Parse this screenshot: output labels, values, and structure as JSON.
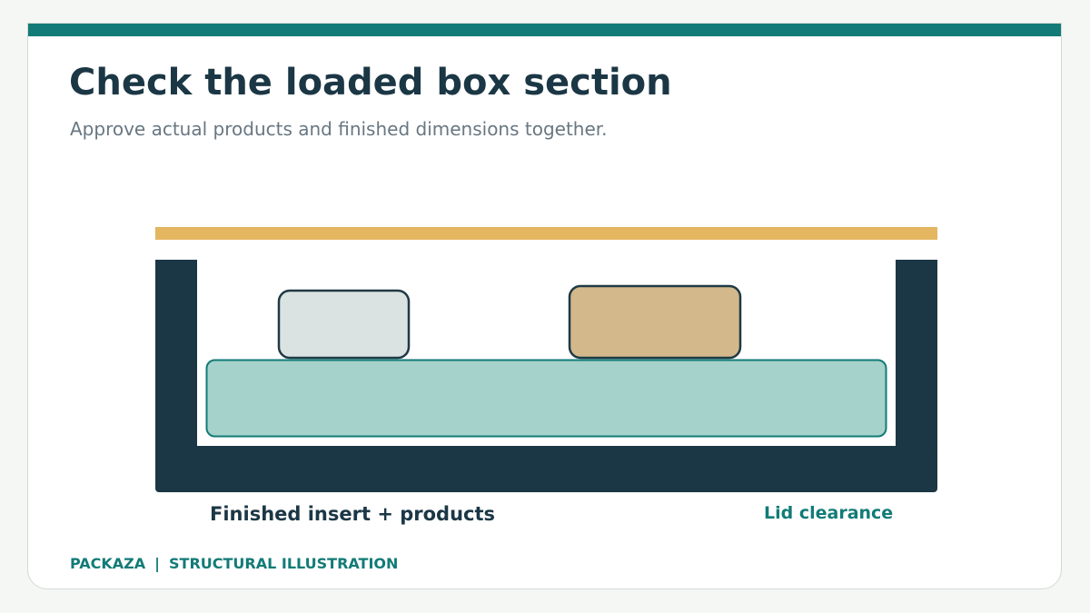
{
  "slide": {
    "title": "Check the loaded box section",
    "subtitle": "Approve actual products and finished dimensions together."
  },
  "diagram": {
    "label_insert": "Finished insert + products",
    "label_clearance": "Lid clearance",
    "parts": [
      "lid",
      "box-wall-left",
      "box-wall-right",
      "box-base",
      "insert",
      "product-left",
      "product-right"
    ]
  },
  "footer": {
    "brand": "PACKAZA",
    "separator": "|",
    "tag": "STRUCTURAL ILLUSTRATION"
  },
  "colors": {
    "accent": "#127b77",
    "dark": "#1b3745",
    "lid": "#e3b65f",
    "insert": "#a5d2ca",
    "product_light": "#dae3e1",
    "product_tan": "#d2b88b"
  }
}
